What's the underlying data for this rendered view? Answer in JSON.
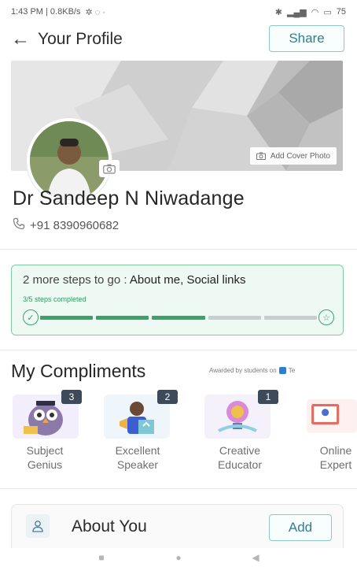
{
  "status_bar": {
    "time_speed": "1:43 PM | 0.8KB/s",
    "battery": "75"
  },
  "header": {
    "title": "Your Profile",
    "share_label": "Share",
    "back_icon": "arrow-left-icon"
  },
  "cover": {
    "add_cover_label": "Add Cover Photo"
  },
  "profile": {
    "name": "Dr Sandeep N Niwadange",
    "phone": "+91 8390960682"
  },
  "steps": {
    "prefix": "2 more steps to go : ",
    "remaining": "About me, Social links",
    "completed_text": "3/5 steps completed",
    "completed": 3,
    "total": 5,
    "accent": "#3aa36a",
    "track": "#c9cdd1"
  },
  "compliments": {
    "title": "My Compliments",
    "awarded_text": "Awarded by students on",
    "awarded_brand": "Te",
    "badges": [
      {
        "label": "Subject\nGenius",
        "count": "3"
      },
      {
        "label": "Excellent\nSpeaker",
        "count": "2"
      },
      {
        "label": "Creative\nEducator",
        "count": "1"
      },
      {
        "label": "Online\nExpert",
        "count": ""
      }
    ]
  },
  "about": {
    "title": "About You",
    "add_label": "Add"
  },
  "colors": {
    "brand": "#2f7f93",
    "success": "#3aa36a"
  }
}
